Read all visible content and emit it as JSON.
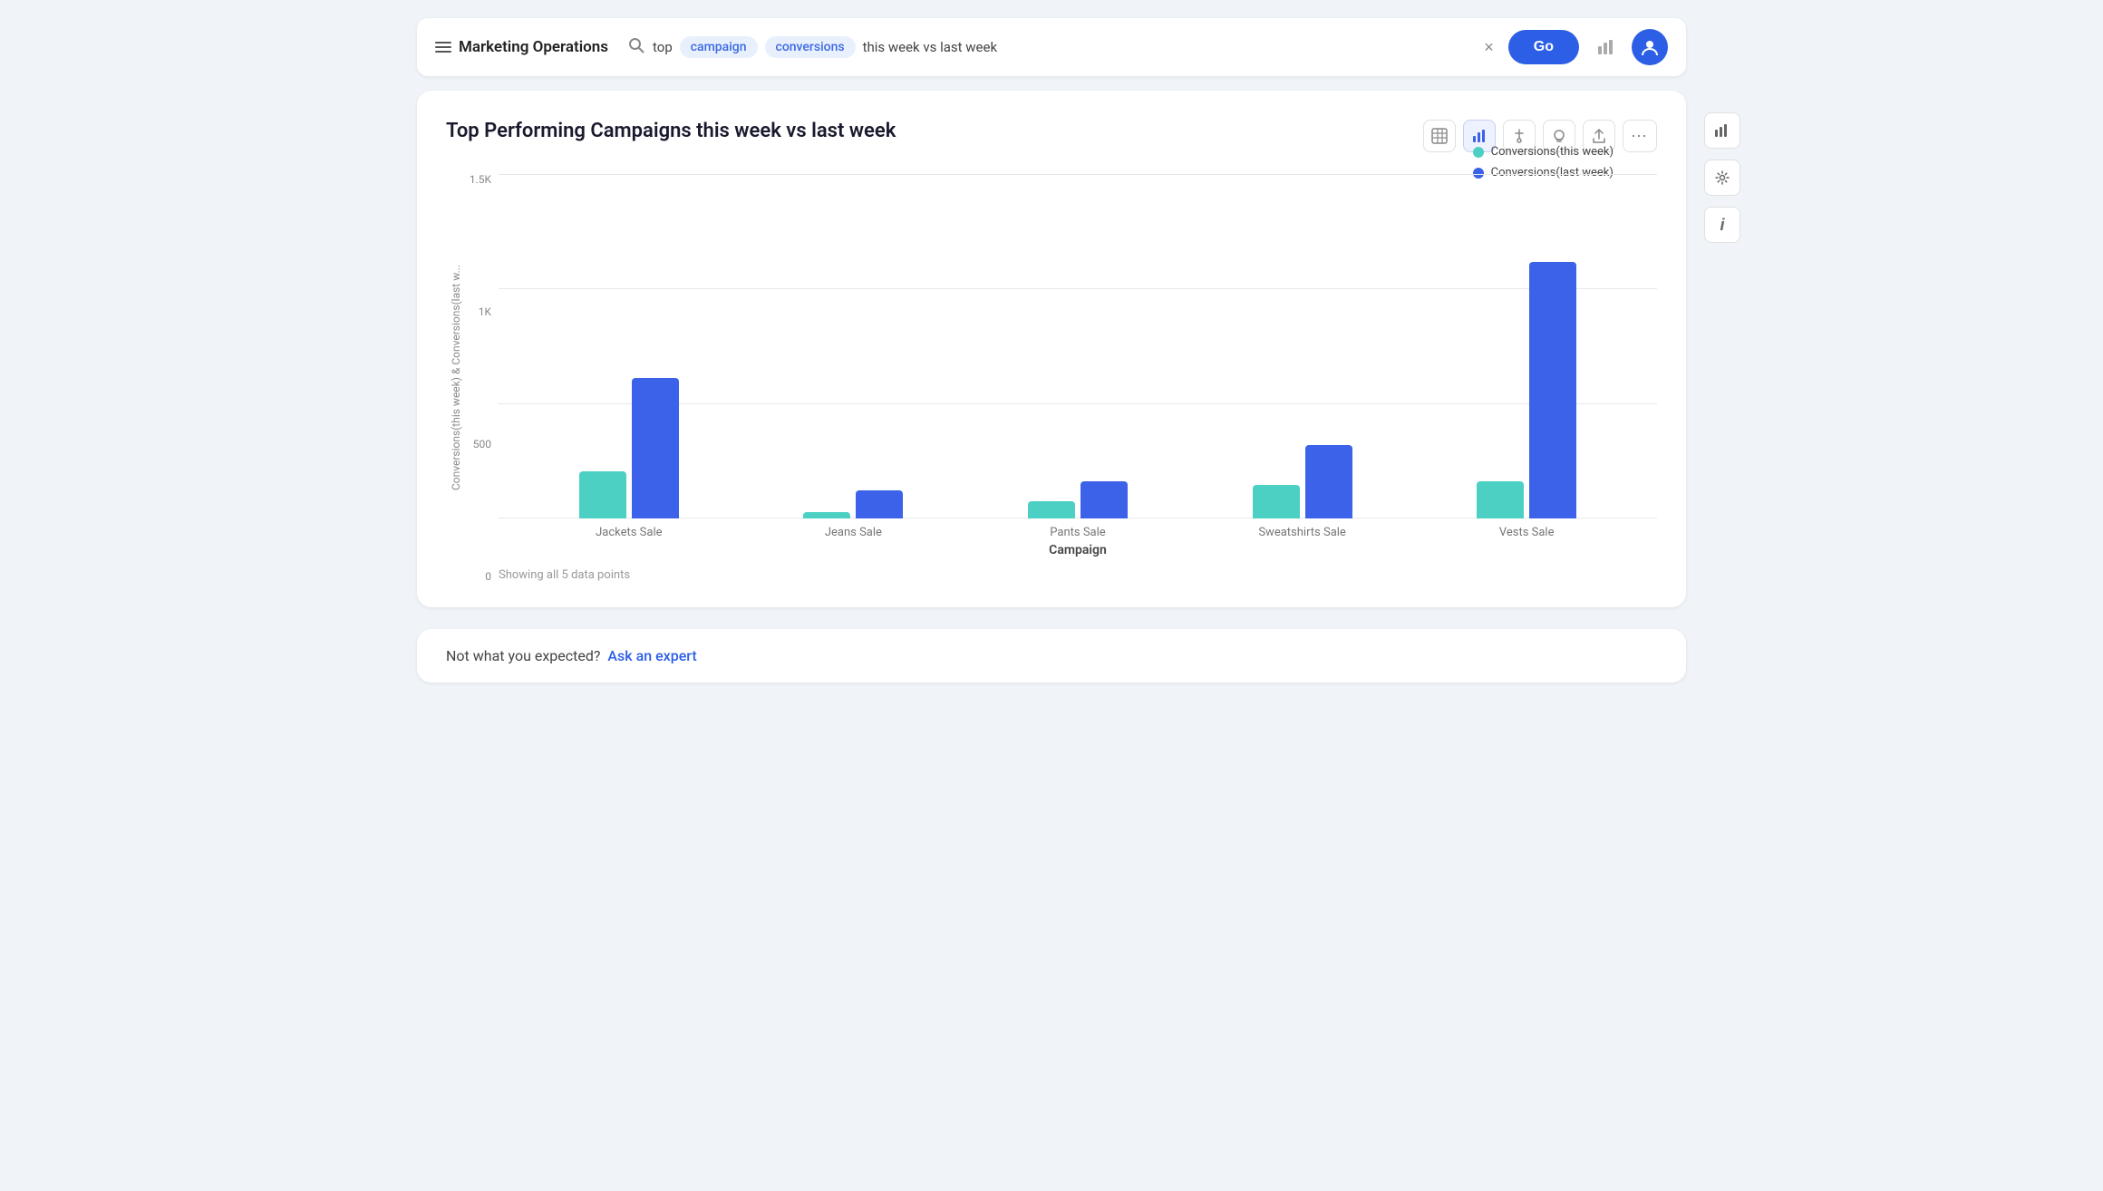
{
  "app": {
    "title": "Marketing Operations"
  },
  "search": {
    "text_plain": "top",
    "token1": "campaign",
    "token2": "conversions",
    "text2": "this week vs last week",
    "clear_label": "×",
    "go_label": "Go"
  },
  "chart": {
    "title": "Top Performing Campaigns this week vs last week",
    "y_axis_label": "Conversions(this week) & Conversions(last w...",
    "x_axis_label": "Campaign",
    "y_ticks": [
      "0",
      "500",
      "1K",
      "1.5K"
    ],
    "data_points_label": "Showing all 5 data points",
    "legend": [
      {
        "label": "Conversions(this week)",
        "color_class": "legend-dot-teal"
      },
      {
        "label": "Conversions(last week)",
        "color_class": "legend-dot-blue"
      }
    ],
    "campaigns": [
      {
        "name": "Jackets Sale",
        "this_week": 220,
        "last_week": 660
      },
      {
        "name": "Jeans Sale",
        "this_week": 30,
        "last_week": 130
      },
      {
        "name": "Pants Sale",
        "this_week": 80,
        "last_week": 175
      },
      {
        "name": "Sweatshirts Sale",
        "this_week": 155,
        "last_week": 345
      },
      {
        "name": "Vests Sale",
        "this_week": 175,
        "last_week": 1200
      }
    ],
    "max_value": 1500
  },
  "toolbar": {
    "table_icon": "▦",
    "bar_chart_icon": "▮",
    "pin_icon": "⬆",
    "bulb_icon": "●",
    "share_icon": "↑",
    "more_icon": "⋯"
  },
  "sidebar_icons": {
    "chart_icon": "📊",
    "gear_icon": "⚙",
    "info_icon": "ⓘ"
  },
  "bottom": {
    "not_expected": "Not what you expected?",
    "ask_expert": "Ask an expert"
  }
}
